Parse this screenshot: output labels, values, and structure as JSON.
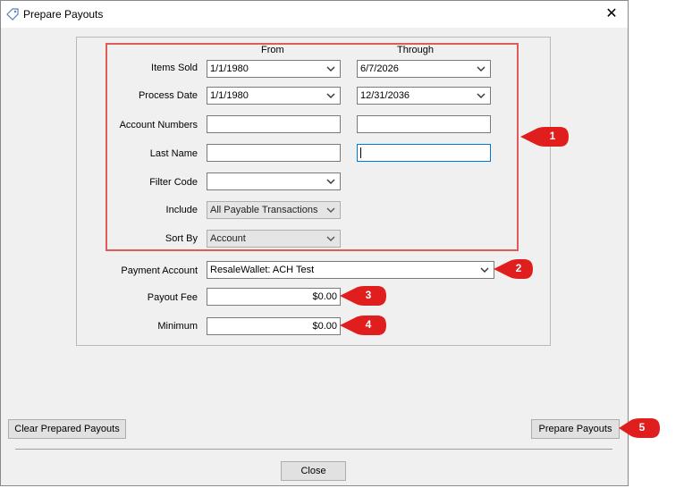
{
  "window": {
    "title": "Prepare Payouts",
    "close_glyph": "✕"
  },
  "columns": {
    "from": "From",
    "through": "Through"
  },
  "fields": {
    "items_sold": {
      "label": "Items Sold",
      "from": "1/1/1980",
      "through": "6/7/2026"
    },
    "process_date": {
      "label": "Process Date",
      "from": "1/1/1980",
      "through": "12/31/2036"
    },
    "account_numbers": {
      "label": "Account Numbers",
      "from": "",
      "through": ""
    },
    "last_name": {
      "label": "Last Name",
      "from": "",
      "through": ""
    },
    "filter_code": {
      "label": "Filter Code",
      "value": ""
    },
    "include": {
      "label": "Include",
      "value": "All Payable Transactions"
    },
    "sort_by": {
      "label": "Sort By",
      "value": "Account"
    },
    "payment_account": {
      "label": "Payment Account",
      "value": "ResaleWallet: ACH Test"
    },
    "payout_fee": {
      "label": "Payout Fee",
      "value": "$0.00"
    },
    "minimum": {
      "label": "Minimum",
      "value": "$0.00"
    }
  },
  "buttons": {
    "clear": "Clear Prepared Payouts",
    "prepare": "Prepare Payouts",
    "close": "Close"
  },
  "callouts": [
    "1",
    "2",
    "3",
    "4",
    "5"
  ],
  "colors": {
    "callout_red": "#e01e1e",
    "highlight_box": "#e05a5a",
    "focus_border": "#0078d7"
  }
}
